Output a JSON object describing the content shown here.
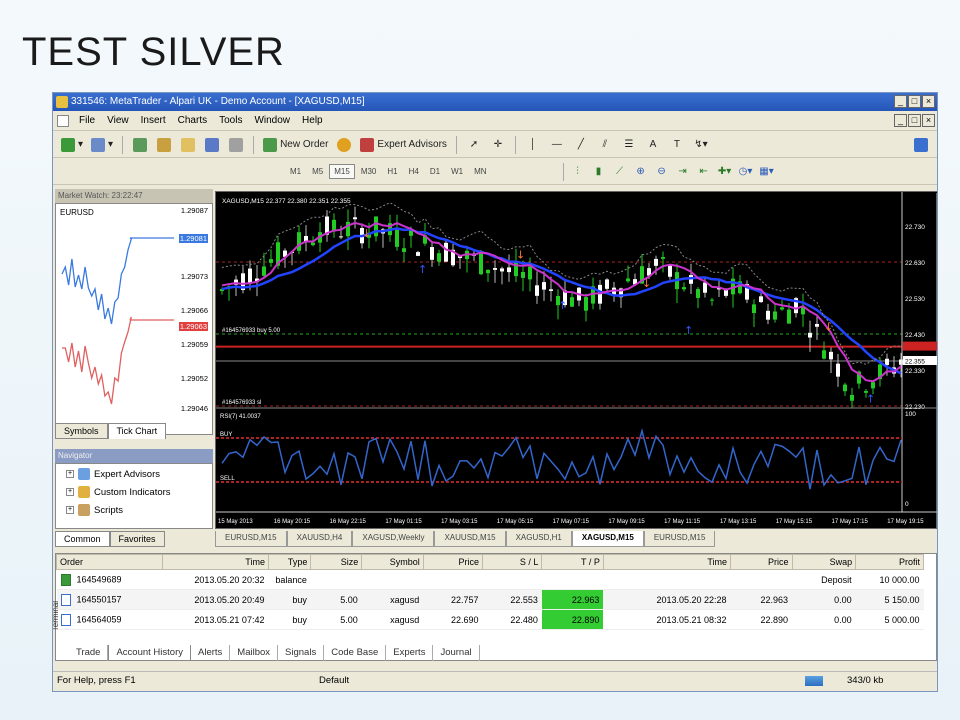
{
  "slide": {
    "title": "TEST SILVER"
  },
  "window": {
    "title": "331546: MetaTrader - Alpari UK - Demo Account - [XAGUSD,M15]",
    "controls": [
      "_",
      "□",
      "×"
    ],
    "inner_controls": [
      "_",
      "□",
      "×"
    ]
  },
  "menu": [
    "File",
    "View",
    "Insert",
    "Charts",
    "Tools",
    "Window",
    "Help"
  ],
  "toolbar": {
    "new_order": "New Order",
    "expert_advisors": "Expert Advisors",
    "text_tool": "A"
  },
  "timeframes": [
    "M1",
    "M5",
    "M15",
    "M30",
    "H1",
    "H4",
    "D1",
    "W1",
    "MN"
  ],
  "active_timeframe": "M15",
  "market_watch": {
    "title": "Market Watch: 23:22:47",
    "symbol": "EURUSD",
    "price_labels": [
      "1.29087",
      "1.29081",
      "1.29073",
      "1.29066",
      "1.29063",
      "1.29059",
      "1.29052",
      "1.29046"
    ],
    "tabs": [
      "Symbols",
      "Tick Chart"
    ]
  },
  "navigator": {
    "title": "Navigator",
    "items": [
      "Expert Advisors",
      "Custom Indicators",
      "Scripts"
    ],
    "tabs": [
      "Common",
      "Favorites"
    ]
  },
  "chart": {
    "header": "XAGUSD,M15  22.377 22.380 22.351 22.355",
    "price_ticks": [
      "22.730",
      "22.630",
      "22.530",
      "22.430",
      "22.330",
      "22.230"
    ],
    "current_price": "22.355",
    "order_label_buy": "#164576933 buy 5.00",
    "order_label_sl": "#164576933 sl",
    "rsi_header": "RSI(7) 41.0037",
    "rsi_buy": "BUY",
    "rsi_sell": "SELL",
    "rsi_ticks": [
      "100",
      "0"
    ],
    "time_ticks": [
      "15 May 2013",
      "16 May 20:15",
      "16 May 22:15",
      "17 May 01:15",
      "17 May 03:15",
      "17 May 05:15",
      "17 May 07:15",
      "17 May 09:15",
      "17 May 11:15",
      "17 May 13:15",
      "17 May 15:15",
      "17 May 17:15",
      "17 May 19:15"
    ],
    "colors": {
      "bg": "#000000",
      "up": "#22cc22",
      "down": "#ffffff",
      "ma_fast": "#cc33cc",
      "ma_slow": "#2244ff",
      "rsi": "#3366cc"
    }
  },
  "chart_tabs": [
    "EURUSD,M15",
    "XAUUSD,H4",
    "XAGUSD,Weekly",
    "XAUUSD,M15",
    "XAGUSD,H1",
    "XAGUSD,M15",
    "EURUSD,M15"
  ],
  "active_chart_tab": "XAGUSD,M15",
  "terminal": {
    "columns": [
      "Order",
      "Time",
      "Type",
      "Size",
      "Symbol",
      "Price",
      "S / L",
      "T / P",
      "Time",
      "Price",
      "Swap",
      "Profit"
    ],
    "rows": [
      {
        "order": "164549689",
        "time": "2013.05.20 20:32",
        "type": "balance",
        "size": "",
        "symbol": "",
        "price": "",
        "sl": "",
        "tp": "",
        "ctime": "",
        "cprice": "",
        "swap": "Deposit",
        "profit": "10 000.00"
      },
      {
        "order": "164550157",
        "time": "2013.05.20 20:49",
        "type": "buy",
        "size": "5.00",
        "symbol": "xagusd",
        "price": "22.757",
        "sl": "22.553",
        "tp": "22.963",
        "ctime": "2013.05.20 22:28",
        "cprice": "22.963",
        "swap": "0.00",
        "profit": "5 150.00"
      },
      {
        "order": "164564059",
        "time": "2013.05.21 07:42",
        "type": "buy",
        "size": "5.00",
        "symbol": "xagusd",
        "price": "22.690",
        "sl": "22.480",
        "tp": "22.890",
        "ctime": "2013.05.21 08:32",
        "cprice": "22.890",
        "swap": "0.00",
        "profit": "5 000.00"
      }
    ],
    "tabs": [
      "Trade",
      "Account History",
      "Alerts",
      "Mailbox",
      "Signals",
      "Code Base",
      "Experts",
      "Journal"
    ],
    "active_tab": "Account History",
    "side_label": "Terminal"
  },
  "status": {
    "help": "For Help, press F1",
    "profile": "Default",
    "traffic": "343/0 kb"
  }
}
